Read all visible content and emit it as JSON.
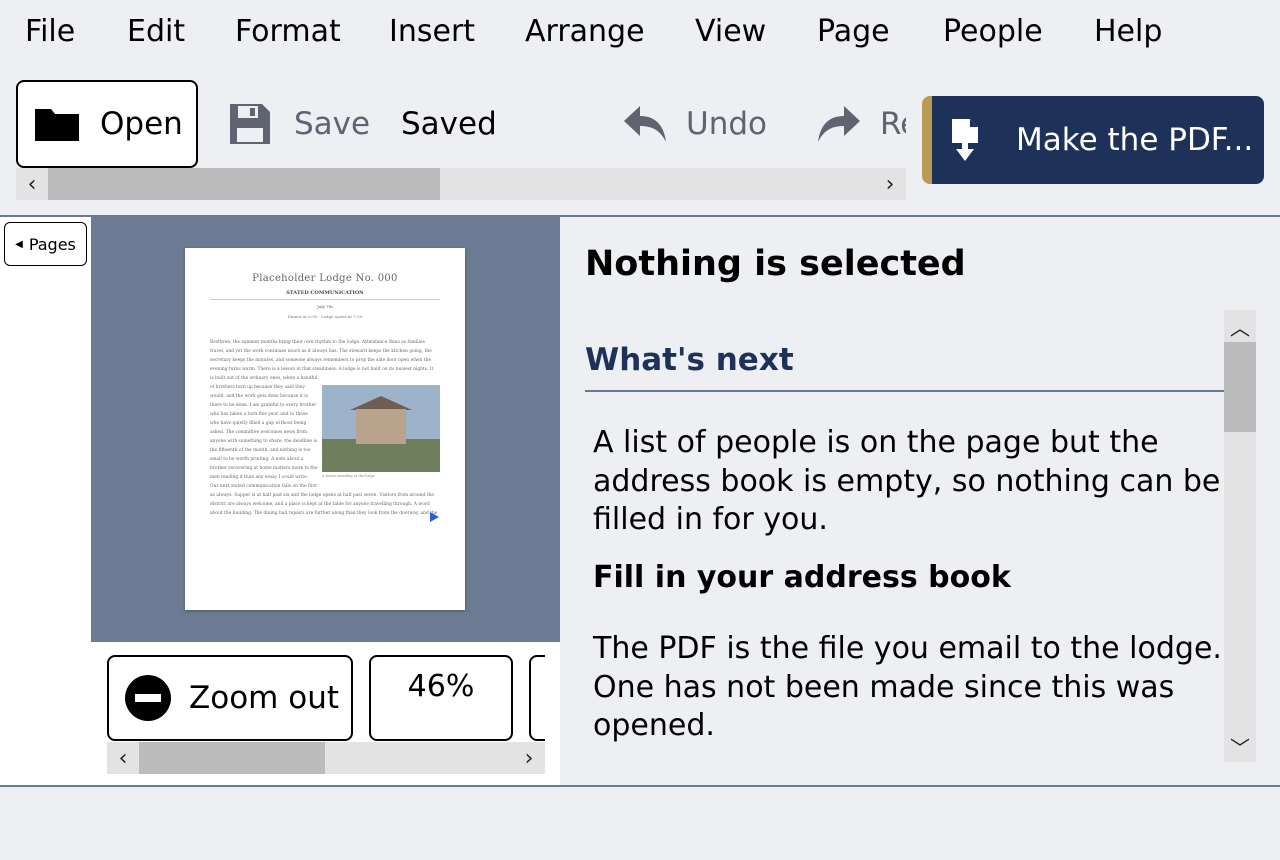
{
  "menu": [
    {
      "label": "File"
    },
    {
      "label": "Edit"
    },
    {
      "label": "Format"
    },
    {
      "label": "Insert"
    },
    {
      "label": "Arrange"
    },
    {
      "label": "View"
    },
    {
      "label": "Page"
    },
    {
      "label": "People"
    },
    {
      "label": "Help"
    }
  ],
  "toolbar": {
    "open_label": "Open",
    "save_label": "Save",
    "saved_status": "Saved",
    "undo_label": "Undo",
    "redo_label": "Re",
    "make_pdf_label": "Make the PDF..."
  },
  "sidebar": {
    "pages_button": "Pages"
  },
  "document_preview": {
    "title": "Placeholder Lodge No. 000",
    "subtitle": "STATED COMMUNICATION",
    "date": "July 7th",
    "dinner_line": "Dinner at 6:30 · Lodge opens at 7:30",
    "paragraph_top": "Brethren, the summer months bring their own rhythm to the lodge. Attendance thins as families travel, and yet the work continues much as it always has. The steward keeps the kitchen going, the secretary keeps the minutes, and someone always remembers to prop the side door open when the evening turns warm. There is a lesson in that steadiness. A lodge is not built on its busiest nights. It",
    "paragraph_left": "is built out of the ordinary ones, when a handful of brothers turn up because they said they would, and the work gets done because it is there to be done. I am grateful to every brother who has taken a turn this year, and to those who have quietly filled a gap without being asked. The committee welcomes news from anyone with something to share; the deadline is the fifteenth of the month, and nothing is too small to be worth printing. A note about a brother recovering at home matters more to the men reading it than any essay I could write. Our next stated communication falls on the first Tuesday,",
    "paragraph_bottom": "as always. Supper is at half past six and the lodge opens at half past seven. Visitors from around the district are always welcome, and a place is kept at the table for anyone travelling through. A word about the building. The dining hall repairs are further along than they look from the doorway, and the",
    "image_caption": "A house standing at the lodge"
  },
  "zoom": {
    "zoom_out_label": "Zoom out",
    "level": "46%"
  },
  "panel": {
    "selection_heading": "Nothing is selected",
    "whats_next_heading": "What's next",
    "address_book_message": "A list of people is on the page but the address book is empty, so nothing can be filled in for you.",
    "fill_address_book_heading": "Fill in your address book",
    "pdf_message": "The PDF is the file you email to the lodge. One has not been made since this was opened."
  },
  "colors": {
    "accent_navy": "#1e3159",
    "accent_gold": "#b89a55",
    "preview_background": "#6c7a93",
    "page_background": "#eeeff3"
  },
  "icons": {
    "open": "folder-icon",
    "save": "floppy-disk-icon",
    "undo": "undo-arrow-icon",
    "redo": "redo-arrow-icon",
    "make_pdf": "pdf-download-icon",
    "zoom_out": "minus-circle-icon"
  }
}
